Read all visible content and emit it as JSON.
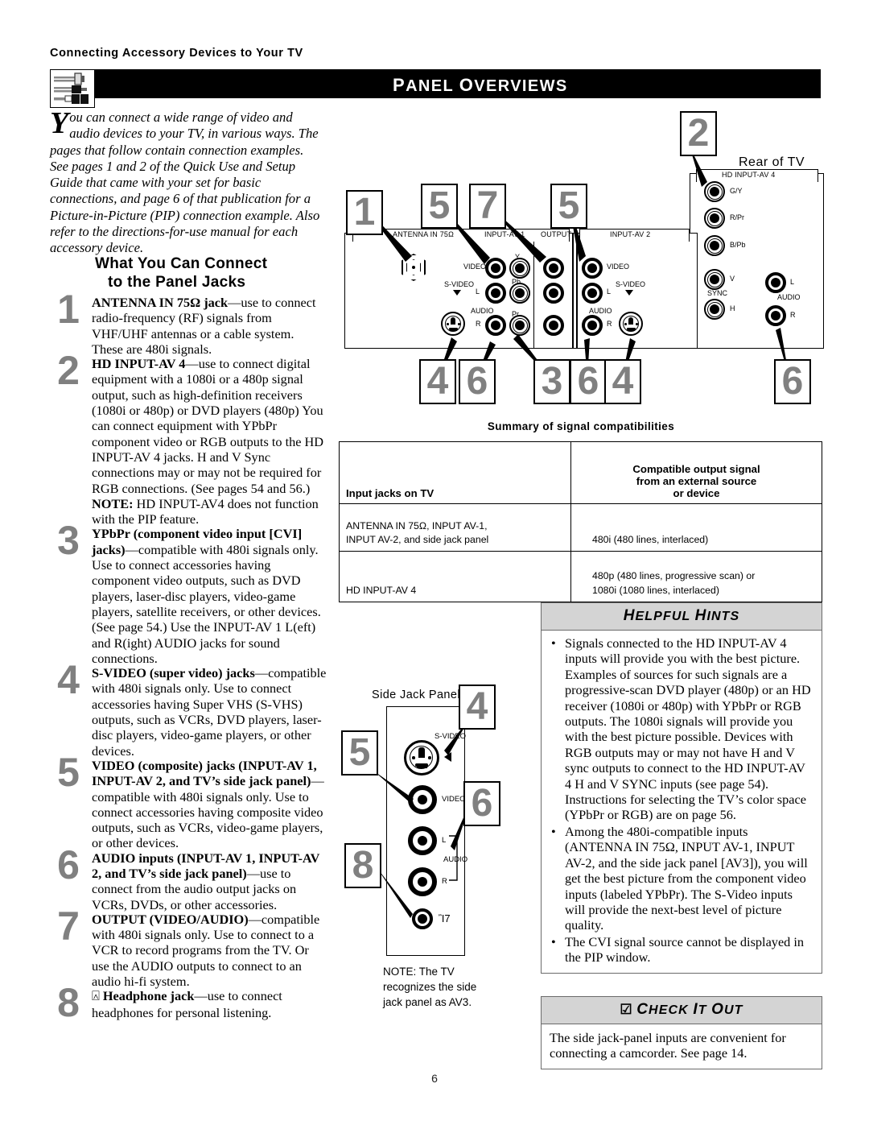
{
  "breadcrumb": "Connecting Accessory Devices to Your TV",
  "header": {
    "title_a": "P",
    "title_b": "ANEL ",
    "title_c": "O",
    "title_d": "VERVIEWS",
    "icon": "av-cables-icon",
    "bar_color": "#000000"
  },
  "intro": {
    "dropcap": "Y",
    "text": "ou can connect a wide range of video and audio devices to your TV, in various ways. The pages that follow contain connection examples. See pages 1 and 2 of the Quick Use and Setup Guide that came with your set for basic connections, and page 6 of that publication for a Picture-in-Picture (PIP) connection example. Also refer to the directions-for-use manual for each accessory device."
  },
  "section_title": {
    "line1": "What You Can Connect",
    "line2": "to the Panel Jacks"
  },
  "items": [
    {
      "num": "1",
      "bold": "ANTENNA IN 75Ω jack",
      "rest": "—use to connect radio-frequency (RF) signals from VHF/UHF antennas or a cable system. These are 480i signals."
    },
    {
      "num": "2",
      "bold": "HD INPUT-AV 4",
      "rest": "—use to connect digital equipment with a 1080i or a 480p signal output, such as high-definition receivers (1080i or 480p) or DVD players (480p) You can connect equipment with YPbPr component video or RGB outputs to the HD INPUT-AV 4 jacks. H and V Sync connections may or may not be required for RGB connections. (See pages 54 and 56.)",
      "note_bold": "NOTE:",
      "note_rest": " HD INPUT-AV4 does not function with the PIP feature."
    },
    {
      "num": "3",
      "bold": "YPbPr (component video input [CVI] jacks)",
      "rest": "—compatible with 480i signals only. Use to connect accessories having component video outputs, such as DVD players, laser-disc players, video-game players, satellite receivers, or other devices. (See page 54.) Use the INPUT-AV 1 L(eft) and R(ight) AUDIO jacks for sound connections."
    },
    {
      "num": "4",
      "bold": "S-VIDEO (super video) jacks",
      "rest": "—compatible with 480i signals only. Use to connect accessories having Super VHS (S-VHS) outputs, such as VCRs, DVD players, laser-disc players, video-game players, or other devices."
    },
    {
      "num": "5",
      "bold": "VIDEO (composite) jacks (INPUT-AV 1, INPUT-AV 2, and TV’s side jack panel)",
      "rest": "—compatible with 480i signals only. Use to connect accessories having composite video outputs, such as VCRs, video-game players, or other devices."
    },
    {
      "num": "6",
      "bold": "AUDIO inputs (INPUT-AV 1, INPUT-AV 2, and TV’s side jack panel)",
      "rest": "—use to connect from the audio output jacks on VCRs, DVDs, or other accessories."
    },
    {
      "num": "7",
      "bold": "OUTPUT (VIDEO/AUDIO)",
      "rest": "—compatible with 480i signals only. Use to connect to a VCR to record programs from the TV. Or use the AUDIO outputs to connect to an audio hi-fi system."
    },
    {
      "num": "8",
      "glyph": "Ἲ7",
      "bold": "Headphone jack",
      "rest": "—use to connect headphones for personal listening."
    }
  ],
  "rear_diagram": {
    "rear_label": "Rear of TV",
    "callouts": [
      "1",
      "5",
      "7",
      "5",
      "2",
      "4",
      "6",
      "3",
      "6",
      "4",
      "6"
    ],
    "strips": [
      "ANTENNA IN 75Ω",
      "INPUT-AV 1",
      "OUTPUT",
      "INPUT-AV 2",
      "HD INPUT-AV 4"
    ],
    "jack_labels": {
      "video": "VIDEO",
      "svideo": "S-VIDEO",
      "audio": "AUDIO",
      "left": "L",
      "right": "R",
      "y": "Y",
      "pb": "Pb",
      "pr": "Pr",
      "gy": "G/Y",
      "rpr": "R/Pr",
      "bpb": "B/Pb",
      "v": "V",
      "h": "H",
      "sync": "SYNC"
    }
  },
  "table": {
    "title": "Summary of signal compatibilities",
    "headers": {
      "col1": "Input jacks on TV",
      "col2_l1": "Compatible output signal",
      "col2_l2": "from an external source",
      "col2_l3": "or device"
    },
    "rows": [
      {
        "jacks_l1": "ANTENNA IN 75Ω, INPUT AV-1,",
        "jacks_l2": "INPUT AV-2, and side jack panel",
        "signal_l1": "480i (480 lines, interlaced)",
        "signal_l2": ""
      },
      {
        "jacks_l1": "HD INPUT-AV 4",
        "jacks_l2": "",
        "signal_l1": "480p (480 lines, progressive scan) or",
        "signal_l2": "1080i (1080 lines, interlaced)"
      }
    ]
  },
  "side_panel": {
    "title": "Side Jack Panel",
    "callouts": [
      "4",
      "5",
      "6",
      "8"
    ],
    "labels": {
      "svideo": "S-VIDEO",
      "video": "VIDEO",
      "left": "L",
      "right": "R",
      "audio": "AUDIO",
      "headphone": "Ἲ7"
    },
    "note": "NOTE: The TV recognizes the side jack panel as AV3."
  },
  "hints": {
    "heading_a": "H",
    "heading_b": "ELPFUL ",
    "heading_c": "H",
    "heading_d": "INTS",
    "bullets": [
      "Signals connected to the HD INPUT-AV 4 inputs will provide you with the best picture. Examples of sources for such signals are a progressive-scan DVD player (480p) or an HD receiver (1080i or 480p) with YPbPr or RGB outputs. The 1080i signals will provide you with the best picture possible. Devices with RGB outputs may or may not have H and V sync outputs to connect to the HD INPUT-AV 4 H and V SYNC inputs (see page 54). Instructions for selecting the TV’s color space (YPbPr or RGB) are on page 56.",
      "Among the 480i-compatible inputs (ANTENNA IN 75Ω, INPUT AV-1, INPUT AV-2, and the side jack panel [AV3]), you will get the best picture from the component video inputs (labeled YPbPr). The S-Video inputs will provide the next-best level of picture quality.",
      "The CVI signal source cannot be displayed in the PIP window."
    ]
  },
  "check": {
    "glyph": "☑",
    "heading_a": "C",
    "heading_b": "HECK ",
    "heading_c": "I",
    "heading_d": "T ",
    "heading_e": "O",
    "heading_f": "UT",
    "body": "The side jack-panel inputs are convenient for connecting a camcorder. See page 14."
  },
  "page_number": "6"
}
